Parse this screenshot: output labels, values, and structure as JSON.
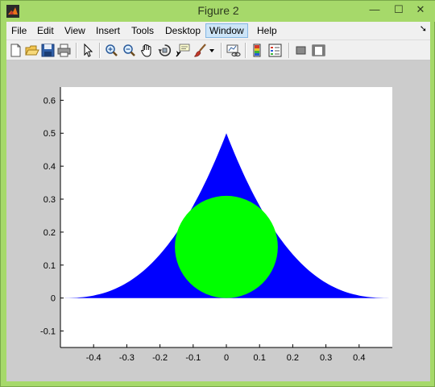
{
  "window": {
    "title": "Figure 2",
    "controls": {
      "minimize": "—",
      "maximize": "☐",
      "close": "✕"
    }
  },
  "menubar": {
    "items": [
      {
        "label": "File",
        "name": "menu-file"
      },
      {
        "label": "Edit",
        "name": "menu-edit"
      },
      {
        "label": "View",
        "name": "menu-view"
      },
      {
        "label": "Insert",
        "name": "menu-insert"
      },
      {
        "label": "Tools",
        "name": "menu-tools"
      },
      {
        "label": "Desktop",
        "name": "menu-desktop"
      },
      {
        "label": "Window",
        "name": "menu-window",
        "active": true
      },
      {
        "label": "Help",
        "name": "menu-help"
      }
    ],
    "overflow_arrow": "➘"
  },
  "toolbar": {
    "buttons": [
      "new-figure-icon",
      "open-file-icon",
      "save-figure-icon",
      "print-figure-icon",
      "edit-plot-arrow-icon",
      "zoom-in-icon",
      "zoom-out-icon",
      "pan-hand-icon",
      "rotate-3d-icon",
      "data-cursor-icon",
      "brush-icon",
      "brush-dropdown-icon",
      "link-plot-icon",
      "insert-colorbar-icon",
      "insert-legend-icon",
      "hide-plot-tools-icon",
      "show-plot-tools-icon"
    ]
  },
  "colors": {
    "titlebar": "#a6d96a",
    "figure_background": "#cccccc",
    "axes_background": "#ffffff",
    "curved_triangle_fill": "#0000ff",
    "circle_fill": "#00ff00"
  },
  "chart_data": {
    "type": "area",
    "xlim": [
      -0.5,
      0.5
    ],
    "ylim": [
      -0.15,
      0.64
    ],
    "xticks": [
      -0.4,
      -0.3,
      -0.2,
      -0.1,
      0,
      0.1,
      0.2,
      0.3,
      0.4
    ],
    "xtick_labels": [
      "-0.4",
      "-0.3",
      "-0.2",
      "-0.1",
      "0",
      "0.1",
      "0.2",
      "0.3",
      "0.4"
    ],
    "yticks": [
      -0.1,
      0,
      0.1,
      0.2,
      0.3,
      0.4,
      0.5,
      0.6
    ],
    "ytick_labels": [
      "-0.1",
      "0",
      "0.1",
      "0.2",
      "0.3",
      "0.4",
      "0.5",
      "0.6"
    ],
    "grid": false,
    "shapes": [
      {
        "name": "curved-triangle",
        "kind": "region between two concave arcs and the x-axis",
        "apex": [
          0,
          0.5
        ],
        "base_left": [
          -0.5,
          0
        ],
        "base_right": [
          0.5,
          0
        ],
        "fill": "#0000ff"
      },
      {
        "name": "inscribed-circle",
        "kind": "circle",
        "center": [
          0,
          0.155
        ],
        "radius": 0.155,
        "fill": "#00ff00"
      }
    ]
  }
}
